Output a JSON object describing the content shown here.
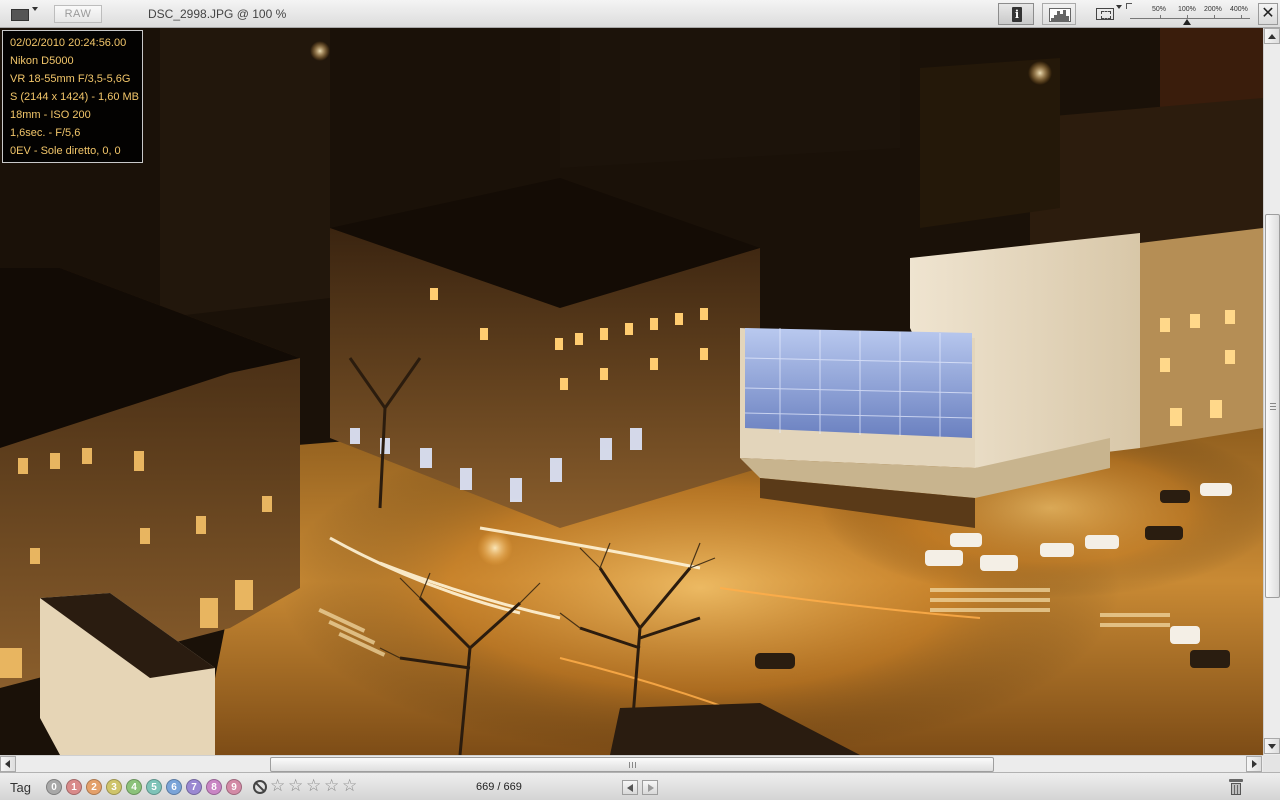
{
  "toolbar": {
    "raw_label": "RAW",
    "title": "DSC_2998.JPG @ 100 %",
    "zoom_labels": [
      "50%",
      "100%",
      "200%",
      "400%"
    ],
    "close_glyph": "✕",
    "info_glyph": "i",
    "icons": {
      "swatch": "background-color-swatch-icon",
      "info": "info-icon",
      "histogram": "histogram-icon",
      "fit": "fit-to-screen-icon",
      "close": "close-icon"
    }
  },
  "exif": {
    "lines": [
      "02/02/2010 20:24:56.00",
      "Nikon D5000",
      "VR 18-55mm F/3,5-5,6G",
      "S (2144 x 1424) - 1,60 MB",
      "18mm - ISO 200",
      "1,6sec. - F/5,6",
      "0EV - Sole diretto, 0, 0"
    ]
  },
  "bottombar": {
    "tag_label": "Tag",
    "tags": [
      {
        "label": "0",
        "color": "#a8a8a8"
      },
      {
        "label": "1",
        "color": "#d98a8a"
      },
      {
        "label": "2",
        "color": "#e4a06a"
      },
      {
        "label": "3",
        "color": "#cfc46a"
      },
      {
        "label": "4",
        "color": "#8cc27a"
      },
      {
        "label": "5",
        "color": "#7ec3b8"
      },
      {
        "label": "6",
        "color": "#7aa4d8"
      },
      {
        "label": "7",
        "color": "#9a88d2"
      },
      {
        "label": "8",
        "color": "#c985c4"
      },
      {
        "label": "9",
        "color": "#d38aa6"
      }
    ],
    "rating_max": 5,
    "rating_value": 0,
    "star_glyph": "☆",
    "counter": "669 / 669",
    "icons": {
      "no_rating": "no-rating-icon",
      "prev": "previous-arrow-icon",
      "next": "next-arrow-icon",
      "trash": "trash-icon"
    }
  },
  "colors": {
    "exif_text": "#f2c66a",
    "exif_bg": "#000000"
  }
}
